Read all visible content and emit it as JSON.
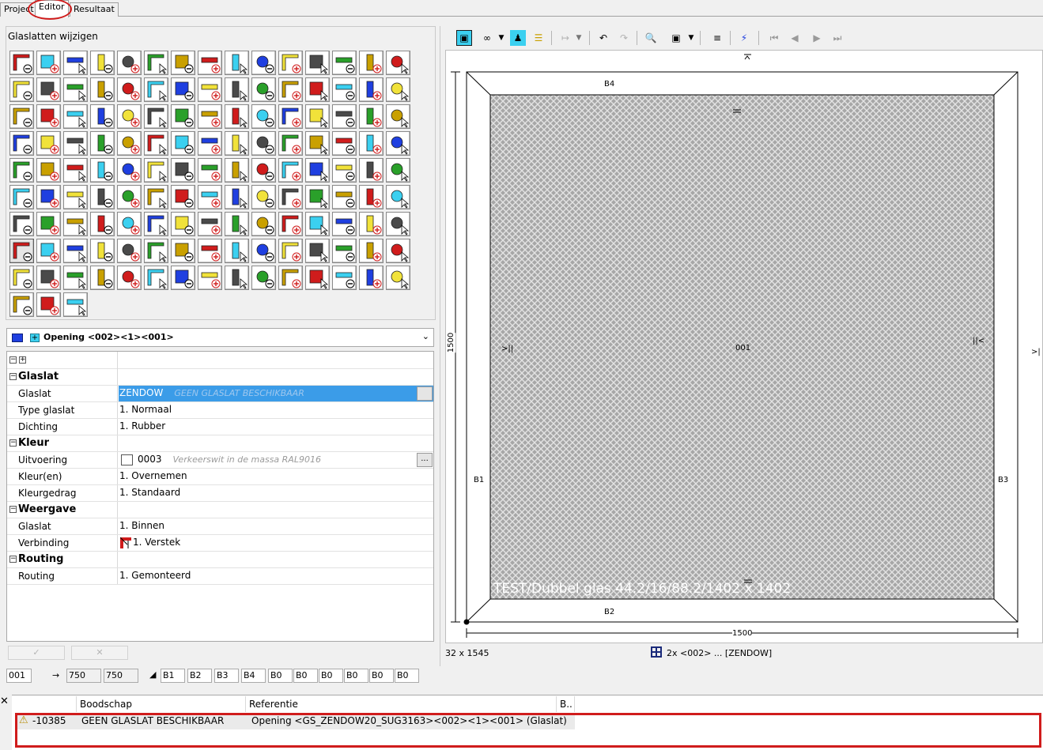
{
  "tabs": {
    "project": "Project",
    "editor": "Editor",
    "resultaat": "Resultaat"
  },
  "left": {
    "group_title": "Glaslatten wijzigen",
    "selector": "Opening <002><1><001>",
    "properties": {
      "categories": {
        "glaslat": "Glaslat",
        "kleur": "Kleur",
        "weergave": "Weergave",
        "routing": "Routing"
      },
      "rows": {
        "glaslat_label": "Glaslat",
        "glaslat_value": "ZENDOW",
        "glaslat_hint": "GEEN GLASLAT BESCHIKBAAR",
        "type_label": "Type glaslat",
        "type_value": "1. Normaal",
        "dichting_label": "Dichting",
        "dichting_value": "1. Rubber",
        "uitvoering_label": "Uitvoering",
        "uitvoering_value": "0003",
        "uitvoering_hint": "Verkeerswit in de massa RAL9016",
        "kleuren_label": "Kleur(en)",
        "kleuren_value": "1. Overnemen",
        "kleurgedrag_label": "Kleurgedrag",
        "kleurgedrag_value": "1. Standaard",
        "weergave_glaslat_label": "Glaslat",
        "weergave_glaslat_value": "1. Binnen",
        "verbinding_label": "Verbinding",
        "verbinding_value": "1. Verstek",
        "routing_label": "Routing",
        "routing_value": "1. Gemonteerd"
      },
      "dots": "..."
    },
    "bottom_fields": {
      "id": "001",
      "width": "750",
      "width2": "750",
      "b": [
        "B1",
        "B2",
        "B3",
        "B4",
        "B0",
        "B0",
        "B0",
        "B0",
        "B0",
        "B0"
      ]
    }
  },
  "right": {
    "drawing": {
      "labels": {
        "b1": "B1",
        "b2": "B2",
        "b3": "B3",
        "b4": "B4",
        "center": "001",
        "dim_bottom": "1500",
        "dim_left": "1500",
        "glass_text": "TEST/Dubbel glas 44.2/16/88.2/1402 x 1402"
      },
      "symbols": {
        "left_mark": ">||",
        "right_mark": "||<",
        "outside_mark": ">|"
      }
    },
    "status": {
      "size": "32 x 1545",
      "info": "2x <002> ... [ZENDOW]"
    }
  },
  "messages": {
    "headers": {
      "boodschap": "Boodschap",
      "referentie": "Referentie",
      "b": "B.."
    },
    "rows": [
      {
        "code": "-10385",
        "boodschap": "GEEN GLASLAT BESCHIKBAAR",
        "referentie": "Opening <GS_ZENDOW20_SUG3163><002><1><001> (Glaslat)"
      }
    ]
  },
  "colors": {
    "selection_blue": "#3b9ce8",
    "highlight_red": "#d01c1c",
    "cyan_accent": "#3bd0f0",
    "swatch_blue": "#1f3fe0"
  }
}
